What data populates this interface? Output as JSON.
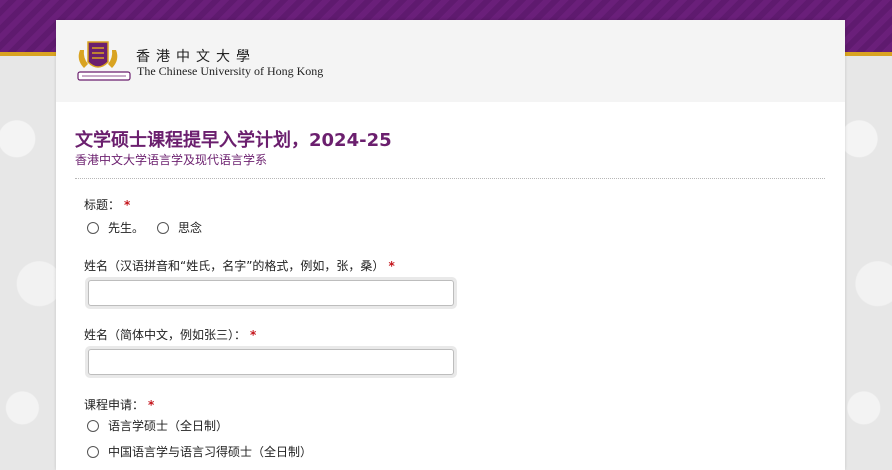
{
  "header": {
    "university_zh": "香港中文大學",
    "university_en": "The Chinese University of Hong Kong",
    "logo_icon": "cuhk-crest-icon"
  },
  "form": {
    "title": "文学硕士课程提早入学计划，2024-25",
    "subtitle": "香港中文大学语言学及现代语言学系",
    "required_mark": "*",
    "salutation": {
      "label": "标题：",
      "options": [
        "先生。",
        "思念"
      ]
    },
    "name_pinyin": {
      "label": "姓名（汉语拼音和“姓氏，名字”的格式，例如，张，桑）",
      "value": "",
      "placeholder": ""
    },
    "name_chinese": {
      "label": "姓名（简体中文，例如张三）：",
      "value": "",
      "placeholder": ""
    },
    "programme": {
      "label": "课程申请：",
      "options": [
        "语言学硕士（全日制）",
        "中国语言学与语言习得硕士（全日制）"
      ]
    }
  },
  "colors": {
    "brand_purple": "#6b1f6e",
    "accent_gold": "#d9a321",
    "required_red": "#c4151c"
  }
}
